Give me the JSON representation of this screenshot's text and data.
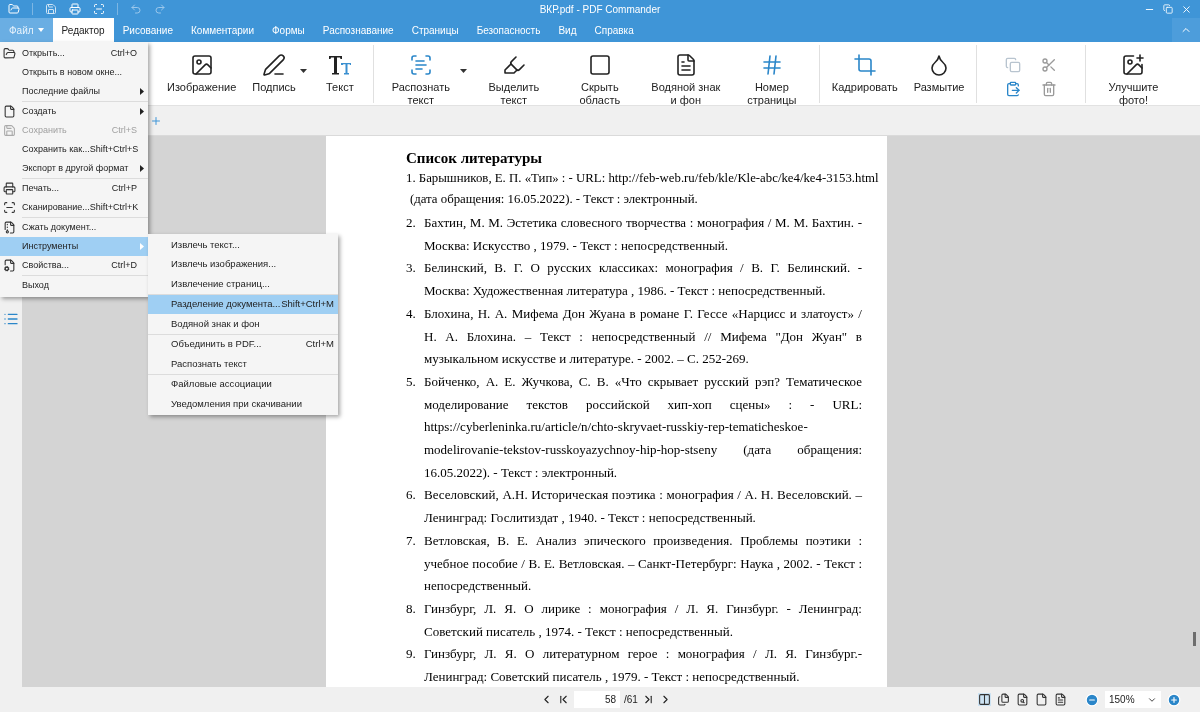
{
  "window": {
    "title": "ВКР.pdf - PDF Commander"
  },
  "menu_tabs": [
    {
      "label": "Файл",
      "selected": false,
      "kind": "file"
    },
    {
      "label": "Редактор",
      "selected": true
    },
    {
      "label": "Рисование",
      "selected": false
    },
    {
      "label": "Комментарии",
      "selected": false
    },
    {
      "label": "Формы",
      "selected": false
    },
    {
      "label": "Распознавание",
      "selected": false
    },
    {
      "label": "Страницы",
      "selected": false
    },
    {
      "label": "Безопасность",
      "selected": false
    },
    {
      "label": "Вид",
      "selected": false
    },
    {
      "label": "Справка",
      "selected": false
    }
  ],
  "ribbon": {
    "groups": [
      [
        {
          "label": "Изображение",
          "dropdown": false
        },
        {
          "label": "Подпись",
          "dropdown": true
        },
        {
          "label": "Текст",
          "dropdown": false
        }
      ],
      [
        {
          "label": "Распознать текст",
          "dropdown": true
        },
        {
          "label": "Выделить текст",
          "dropdown": false
        },
        {
          "label": "Скрыть область",
          "dropdown": false
        },
        {
          "label": "Водяной знак и фон",
          "dropdown": false
        },
        {
          "label": "Номер страницы",
          "dropdown": false
        }
      ],
      [
        {
          "label": "Кадрировать",
          "dropdown": false
        },
        {
          "label": "Размытие",
          "dropdown": false
        }
      ],
      [
        {
          "kind": "clipboard"
        }
      ],
      [
        {
          "label": "Улучшите фото!",
          "dropdown": false
        }
      ]
    ]
  },
  "file_menu": {
    "groups": [
      [
        {
          "label": "Открыть...",
          "shortcut": "Ctrl+O",
          "submenu": false,
          "disabled": false,
          "selected": false
        },
        {
          "label": "Открыть в новом окне...",
          "submenu": false,
          "disabled": false,
          "selected": false
        },
        {
          "label": "Последние файлы",
          "submenu": true,
          "disabled": false,
          "selected": false
        }
      ],
      [
        {
          "label": "Создать",
          "submenu": true,
          "disabled": false,
          "selected": false
        },
        {
          "label": "Сохранить",
          "shortcut": "Ctrl+S",
          "submenu": false,
          "disabled": true,
          "selected": false
        },
        {
          "label": "Сохранить как...",
          "shortcut": "Shift+Ctrl+S",
          "submenu": false,
          "disabled": false,
          "selected": false
        },
        {
          "label": "Экспорт в другой формат",
          "submenu": true,
          "disabled": false,
          "selected": false
        }
      ],
      [
        {
          "label": "Печать...",
          "shortcut": "Ctrl+P",
          "submenu": false,
          "disabled": false,
          "selected": false
        },
        {
          "label": "Сканирование...",
          "shortcut": "Shift+Ctrl+K",
          "submenu": false,
          "disabled": false,
          "selected": false
        }
      ],
      [
        {
          "label": "Сжать документ...",
          "submenu": false,
          "disabled": false,
          "selected": false
        },
        {
          "label": "Инструменты",
          "submenu": true,
          "disabled": false,
          "selected": true
        },
        {
          "label": "Свойства...",
          "shortcut": "Ctrl+D",
          "submenu": false,
          "disabled": false,
          "selected": false
        }
      ],
      [
        {
          "label": "Выход",
          "submenu": false,
          "disabled": false,
          "selected": false
        }
      ]
    ]
  },
  "tools_submenu": {
    "groups": [
      [
        {
          "label": "Извлечь текст...",
          "selected": false
        },
        {
          "label": "Извлечь изображения...",
          "selected": false
        },
        {
          "label": "Извлечение страниц...",
          "selected": false
        }
      ],
      [
        {
          "label": "Разделение документа...",
          "shortcut": "Shift+Ctrl+M",
          "selected": true
        },
        {
          "label": "Водяной знак и фон",
          "selected": false
        }
      ],
      [
        {
          "label": "Объединить в PDF...",
          "shortcut": "Ctrl+M",
          "selected": false
        },
        {
          "label": "Распознать текст",
          "selected": false
        }
      ],
      [
        {
          "label": "Файловые ассоциации",
          "selected": false
        },
        {
          "label": "Уведомления при скачивании",
          "selected": false
        }
      ]
    ]
  },
  "document": {
    "heading": "Список литературы",
    "entries": [
      {
        "kind": "plain",
        "text": "1. Барышников, Е. П. «Тип» : - URL: http://feb-web.ru/feb/kle/Kle-abc/ke4/ke4-3153.html (дата обращения: 16.05.2022). - Текст : электронный."
      },
      {
        "kind": "numbered",
        "number": "2.",
        "text": "Бахтин, М. М. Эстетика словесного творчества : монография / М. М. Бахтин. - Москва: Искусство , 1979. - Текст : непосредственный."
      },
      {
        "kind": "numbered",
        "number": "3.",
        "text": "Белинский, В. Г. О русских классиках: монография / В. Г. Белинский. - Москва: Художественная литература , 1986. - Текст : непосредственный."
      },
      {
        "kind": "numbered",
        "number": "4.",
        "text": "Блохина, Н. А. Мифема Дон Жуана в романе Г. Гессе «Нарцисс и златоуст» / Н. А. Блохина. – Текст : непосредственный // Мифема \"Дон Жуан\" в музыкальном искусстве и литературе. - 2002. – С. 252-269."
      },
      {
        "kind": "numbered",
        "number": "5.",
        "text": "Бойченко, А. Е. Жучкова, С. В. «Что скрывает русский рэп? Тематическое моделирование текстов российской хип-хоп сцены» : - URL: https://cyberleninka.ru/article/n/chto-skryvaet-russkiy-rep-tematicheskoe-modelirovanie-tekstov-russkoyazychnoy-hip-hop-stseny (дата обращения: 16.05.2022). - Текст : электронный."
      },
      {
        "kind": "numbered",
        "number": "6.",
        "text": "Веселовский, А.Н. Историческая поэтика : монография / А. Н. Веселовский. – Ленинград: Гослитиздат , 1940. - Текст : непосредственный."
      },
      {
        "kind": "numbered",
        "number": "7.",
        "text": "Ветловская, В. Е. Анализ эпического произведения. Проблемы поэтики : учебное пособие / В. Е. Ветловская. – Санкт-Петербург: Наука , 2002. - Текст : непосредственный."
      },
      {
        "kind": "numbered",
        "number": "8.",
        "text": "Гинзбург, Л. Я. О лирике : монография / Л. Я. Гинзбург. - Ленинград: Советский писатель , 1974. - Текст : непосредственный."
      },
      {
        "kind": "numbered",
        "number": "9.",
        "text": "Гинзбург, Л. Я. О литературном герое : монография / Л. Я. Гинзбург.- Ленинград: Советский писатель , 1979. - Текст : непосредственный."
      }
    ]
  },
  "status_bar": {
    "page": "58",
    "total": "/61",
    "zoom": "150%"
  }
}
